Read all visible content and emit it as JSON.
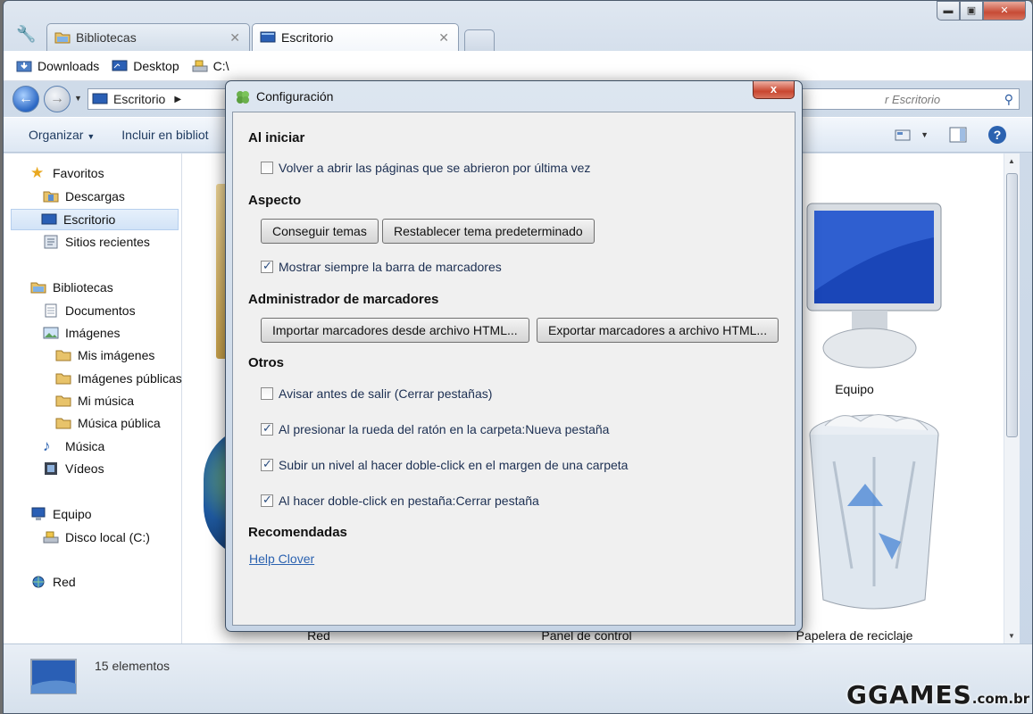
{
  "tabs": [
    {
      "label": "Bibliotecas",
      "icon": "library-folder-icon"
    },
    {
      "label": "Escritorio",
      "icon": "desktop-icon"
    }
  ],
  "bookmarks": [
    {
      "label": "Downloads",
      "icon": "downloads-icon"
    },
    {
      "label": "Desktop",
      "icon": "desktop-icon"
    },
    {
      "label": "C:\\",
      "icon": "drive-icon"
    }
  ],
  "address": {
    "path": "Escritorio",
    "search_placeholder": "Buscar Escritorio",
    "search_visible": "r Escritorio"
  },
  "command_bar": {
    "organize": "Organizar",
    "include": "Incluir en bibliot"
  },
  "nav": {
    "favorites": "Favoritos",
    "downloads": "Descargas",
    "desktop": "Escritorio",
    "recent": "Sitios recientes",
    "libraries": "Bibliotecas",
    "documents": "Documentos",
    "images": "Imágenes",
    "my_images": "Mis imágenes",
    "public_images": "Imágenes públicas",
    "my_music": "Mi música",
    "public_music": "Música pública",
    "music": "Música",
    "videos": "Vídeos",
    "computer": "Equipo",
    "local_disk": "Disco local (C:)",
    "network": "Red"
  },
  "content": {
    "computer": "Equipo",
    "network": "Red",
    "control_panel": "Panel de control",
    "recycle": "Papelera de reciclaje"
  },
  "status": {
    "count": "15 elementos"
  },
  "watermark": {
    "main": "GGAMES",
    "suffix": ".com.br"
  },
  "dialog": {
    "title": "Configuración",
    "close": "x",
    "sections": {
      "startup": "Al iniciar",
      "appearance": "Aspecto",
      "bookmarks_manager": "Administrador de marcadores",
      "others": "Otros",
      "recommended": "Recomendadas"
    },
    "options": {
      "reopen": {
        "label": "Volver a abrir las páginas que se abrieron por última vez",
        "checked": false
      },
      "show_bookmarks": {
        "label": "Mostrar siempre la barra de marcadores",
        "checked": true
      },
      "warn_exit": {
        "label": "Avisar antes de salir (Cerrar pestañas)",
        "checked": false
      },
      "wheel_click": {
        "label": "Al presionar la rueda del ratón en la carpeta:Nueva pestaña",
        "checked": true
      },
      "up_level": {
        "label": "Subir un nivel al hacer doble-click en el margen de una carpeta",
        "checked": true
      },
      "dbl_tab": {
        "label": "Al hacer doble-click en pestaña:Cerrar pestaña",
        "checked": true
      }
    },
    "buttons": {
      "get_themes": "Conseguir temas",
      "reset_theme": "Restablecer tema predeterminado",
      "import": "Importar marcadores desde archivo HTML...",
      "export": "Exportar marcadores a archivo HTML..."
    },
    "help_link": "Help Clover"
  },
  "colors": {
    "accent": "#2b62b0",
    "close_red": "#c9462f"
  }
}
